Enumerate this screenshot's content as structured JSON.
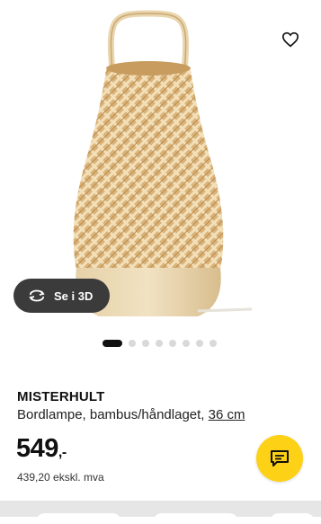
{
  "gallery": {
    "favorite_icon": "heart-outline-icon",
    "view_3d_label": "Se i 3D",
    "view_3d_icon": "rotate-3d-icon",
    "dots_total": 8,
    "dots_active": 0
  },
  "product": {
    "name": "MISTERHULT",
    "description": "Bordlampe, bambus/håndlaget, ",
    "size": "36 cm",
    "price_main": "549",
    "price_suffix": ",-",
    "price_ex_vat": "439,20 ekskl. mva"
  },
  "chat": {
    "icon": "chat-bubble-icon",
    "color": "#fcd116"
  }
}
